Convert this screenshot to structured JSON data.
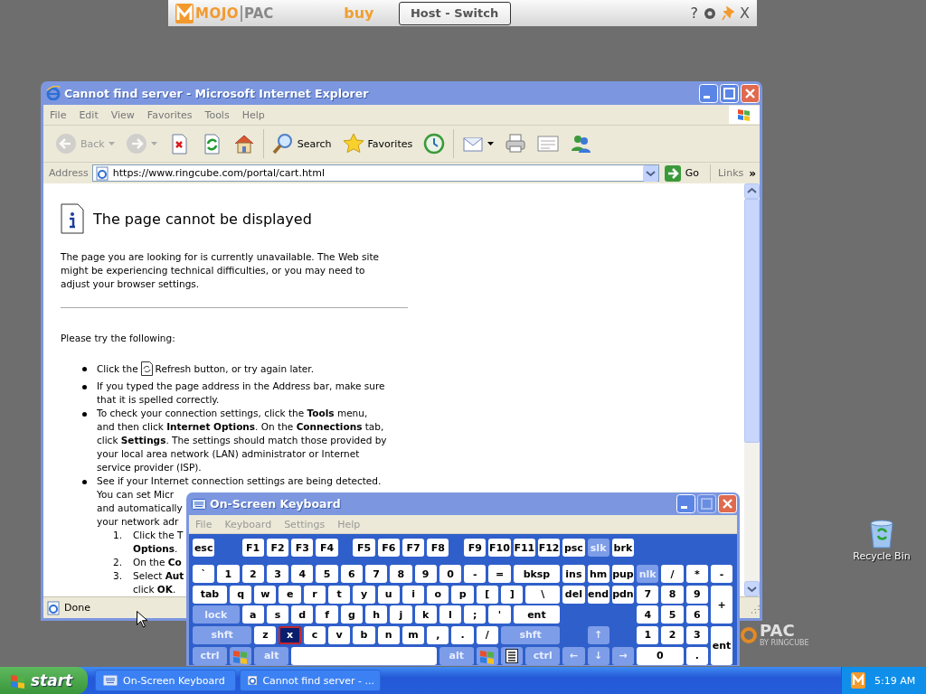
{
  "mojopac_bar": {
    "logo": [
      "MOJO",
      "PAC"
    ],
    "buy": "buy",
    "switch_button": "Host - Switch",
    "help": "?",
    "close": "X"
  },
  "desktop": {
    "icons": [
      {
        "label": "Recycle Bin"
      }
    ],
    "wallpaper_logo": {
      "text": "PAC",
      "tagline": "BY RINGCUBE"
    }
  },
  "browser": {
    "title": "Cannot find server - Microsoft Internet Explorer",
    "menu": [
      "File",
      "Edit",
      "View",
      "Favorites",
      "Tools",
      "Help"
    ],
    "toolbar": [
      {
        "kind": "back",
        "label": "Back",
        "disabled": true
      },
      {
        "kind": "forward",
        "disabled": true
      },
      {
        "kind": "stop",
        "disabled": false
      },
      {
        "kind": "refresh",
        "disabled": false
      },
      {
        "kind": "home",
        "disabled": false
      },
      {
        "kind": "search",
        "label": "Search",
        "disabled": false
      },
      {
        "kind": "favorites",
        "label": "Favorites",
        "disabled": false
      },
      {
        "kind": "history",
        "disabled": false
      },
      {
        "kind": "mail",
        "disabled": false
      },
      {
        "kind": "print",
        "disabled": false
      },
      {
        "kind": "edit",
        "disabled": false
      },
      {
        "kind": "messenger",
        "disabled": false
      }
    ],
    "address": {
      "label": "Address",
      "value": "https://www.ringcube.com/portal/cart.html",
      "go": "Go",
      "links": "Links",
      "chevron": "»"
    },
    "page": {
      "heading": "The page cannot be displayed",
      "intro": "The page you are looking for is currently unavailable. The Web site might be experiencing technical difficulties, or you may need to adjust your browser settings.",
      "prompt": "Please try the following:",
      "bullets": [
        {
          "kind": "refresh",
          "before": "Click the",
          "after": "Refresh button, or try again later."
        },
        {
          "kind": "text",
          "text": "If you typed the page address in the Address bar, make sure that it is spelled correctly."
        },
        {
          "kind": "text",
          "text": "To check your connection settings, click the **Tools** menu, and then click **Internet Options**. On the **Connections** tab, click **Settings**. The settings should match those provided by your local area network (LAN) administrator or Internet service provider (ISP)."
        },
        {
          "kind": "lines",
          "lines": [
            "See if your Internet connection settings are being detected.",
            "You can set Micr",
            "and automatically",
            "your network adr"
          ],
          "steps": [
            {
              "number": "1.",
              "lines": [
                "Click the T",
                "**Options**."
              ]
            },
            {
              "number": "2.",
              "lines": [
                "On the **Co**"
              ]
            },
            {
              "number": "3.",
              "lines": [
                "Select **Aut**",
                "click **OK**."
              ]
            }
          ]
        }
      ]
    },
    "status": "Done"
  },
  "keyboard": {
    "title": "On-Screen Keyboard",
    "menu": [
      "File",
      "Keyboard",
      "Settings",
      "Help"
    ],
    "rows": [
      {
        "keys": [
          {
            "label": "esc",
            "kind": "key"
          },
          {
            "label": "F1",
            "kind": "key"
          },
          {
            "label": "F2",
            "kind": "key"
          },
          {
            "label": "F3",
            "kind": "key"
          },
          {
            "label": "F4",
            "kind": "key"
          },
          {
            "label": "F5",
            "kind": "key"
          },
          {
            "label": "F6",
            "kind": "key"
          },
          {
            "label": "F7",
            "kind": "key"
          },
          {
            "label": "F8",
            "kind": "key"
          },
          {
            "label": "F9",
            "kind": "key"
          },
          {
            "label": "F10",
            "kind": "key"
          },
          {
            "label": "F11",
            "kind": "key"
          },
          {
            "label": "F12",
            "kind": "key"
          },
          {
            "label": "psc",
            "kind": "key"
          },
          {
            "label": "slk",
            "kind": "mod"
          },
          {
            "label": "brk",
            "kind": "key"
          }
        ]
      },
      {
        "keys": [
          {
            "label": "`",
            "kind": "key"
          },
          {
            "label": "1",
            "kind": "key"
          },
          {
            "label": "2",
            "kind": "key"
          },
          {
            "label": "3",
            "kind": "key"
          },
          {
            "label": "4",
            "kind": "key"
          },
          {
            "label": "5",
            "kind": "key"
          },
          {
            "label": "6",
            "kind": "key"
          },
          {
            "label": "7",
            "kind": "key"
          },
          {
            "label": "8",
            "kind": "key"
          },
          {
            "label": "9",
            "kind": "key"
          },
          {
            "label": "0",
            "kind": "key"
          },
          {
            "label": "-",
            "kind": "key"
          },
          {
            "label": "=",
            "kind": "key"
          },
          {
            "label": "bksp",
            "kind": "key"
          },
          {
            "label": "ins",
            "kind": "key"
          },
          {
            "label": "hm",
            "kind": "key"
          },
          {
            "label": "pup",
            "kind": "key"
          },
          {
            "label": "nlk",
            "kind": "mod"
          },
          {
            "label": "/",
            "kind": "key"
          },
          {
            "label": "*",
            "kind": "key"
          },
          {
            "label": "-",
            "kind": "key"
          }
        ]
      },
      {
        "keys": [
          {
            "label": "tab",
            "kind": "key"
          },
          {
            "label": "q",
            "kind": "key"
          },
          {
            "label": "w",
            "kind": "key"
          },
          {
            "label": "e",
            "kind": "key"
          },
          {
            "label": "r",
            "kind": "key"
          },
          {
            "label": "t",
            "kind": "key"
          },
          {
            "label": "y",
            "kind": "key"
          },
          {
            "label": "u",
            "kind": "key"
          },
          {
            "label": "i",
            "kind": "key"
          },
          {
            "label": "o",
            "kind": "key"
          },
          {
            "label": "p",
            "kind": "key"
          },
          {
            "label": "[",
            "kind": "key"
          },
          {
            "label": "]",
            "kind": "key"
          },
          {
            "label": "\\",
            "kind": "key"
          },
          {
            "label": "del",
            "kind": "key"
          },
          {
            "label": "end",
            "kind": "key"
          },
          {
            "label": "pdn",
            "kind": "key"
          },
          {
            "label": "7",
            "kind": "key"
          },
          {
            "label": "8",
            "kind": "key"
          },
          {
            "label": "9",
            "kind": "key"
          },
          {
            "label": "+",
            "kind": "key"
          }
        ]
      },
      {
        "keys": [
          {
            "label": "lock",
            "kind": "mod"
          },
          {
            "label": "a",
            "kind": "key"
          },
          {
            "label": "s",
            "kind": "key"
          },
          {
            "label": "d",
            "kind": "key"
          },
          {
            "label": "f",
            "kind": "key"
          },
          {
            "label": "g",
            "kind": "key"
          },
          {
            "label": "h",
            "kind": "key"
          },
          {
            "label": "j",
            "kind": "key"
          },
          {
            "label": "k",
            "kind": "key"
          },
          {
            "label": "l",
            "kind": "key"
          },
          {
            "label": ";",
            "kind": "key"
          },
          {
            "label": "'",
            "kind": "key"
          },
          {
            "label": "ent",
            "kind": "key"
          },
          {
            "label": "4",
            "kind": "key"
          },
          {
            "label": "5",
            "kind": "key"
          },
          {
            "label": "6",
            "kind": "key"
          }
        ]
      },
      {
        "keys": [
          {
            "label": "shft",
            "kind": "mod"
          },
          {
            "label": "z",
            "kind": "key"
          },
          {
            "label": "x",
            "kind": "focus"
          },
          {
            "label": "c",
            "kind": "key"
          },
          {
            "label": "v",
            "kind": "key"
          },
          {
            "label": "b",
            "kind": "key"
          },
          {
            "label": "n",
            "kind": "key"
          },
          {
            "label": "m",
            "kind": "key"
          },
          {
            "label": ",",
            "kind": "key"
          },
          {
            "label": ".",
            "kind": "key"
          },
          {
            "label": "/",
            "kind": "key"
          },
          {
            "label": "shft",
            "kind": "mod"
          },
          {
            "label": "↑",
            "kind": "mod"
          },
          {
            "label": "1",
            "kind": "key"
          },
          {
            "label": "2",
            "kind": "key"
          },
          {
            "label": "3",
            "kind": "key"
          },
          {
            "label": "ent",
            "kind": "key"
          }
        ]
      },
      {
        "keys": [
          {
            "label": "ctrl",
            "kind": "mod"
          },
          {
            "kind": "win"
          },
          {
            "label": "alt",
            "kind": "mod"
          },
          {
            "kind": "space"
          },
          {
            "label": "alt",
            "kind": "mod"
          },
          {
            "kind": "win"
          },
          {
            "kind": "menu"
          },
          {
            "label": "ctrl",
            "kind": "mod"
          },
          {
            "label": "←",
            "kind": "mod"
          },
          {
            "label": "↓",
            "kind": "mod"
          },
          {
            "label": "→",
            "kind": "mod"
          },
          {
            "label": "0",
            "kind": "key"
          },
          {
            "label": ".",
            "kind": "key"
          }
        ]
      }
    ]
  },
  "taskbar": {
    "start": "start",
    "tasks": [
      {
        "label": "On-Screen Keyboard",
        "kind": "keyboard",
        "selected": false
      },
      {
        "label": "Cannot find server - ...",
        "kind": "browser",
        "selected": false
      }
    ],
    "clock": "5:19 AM"
  }
}
